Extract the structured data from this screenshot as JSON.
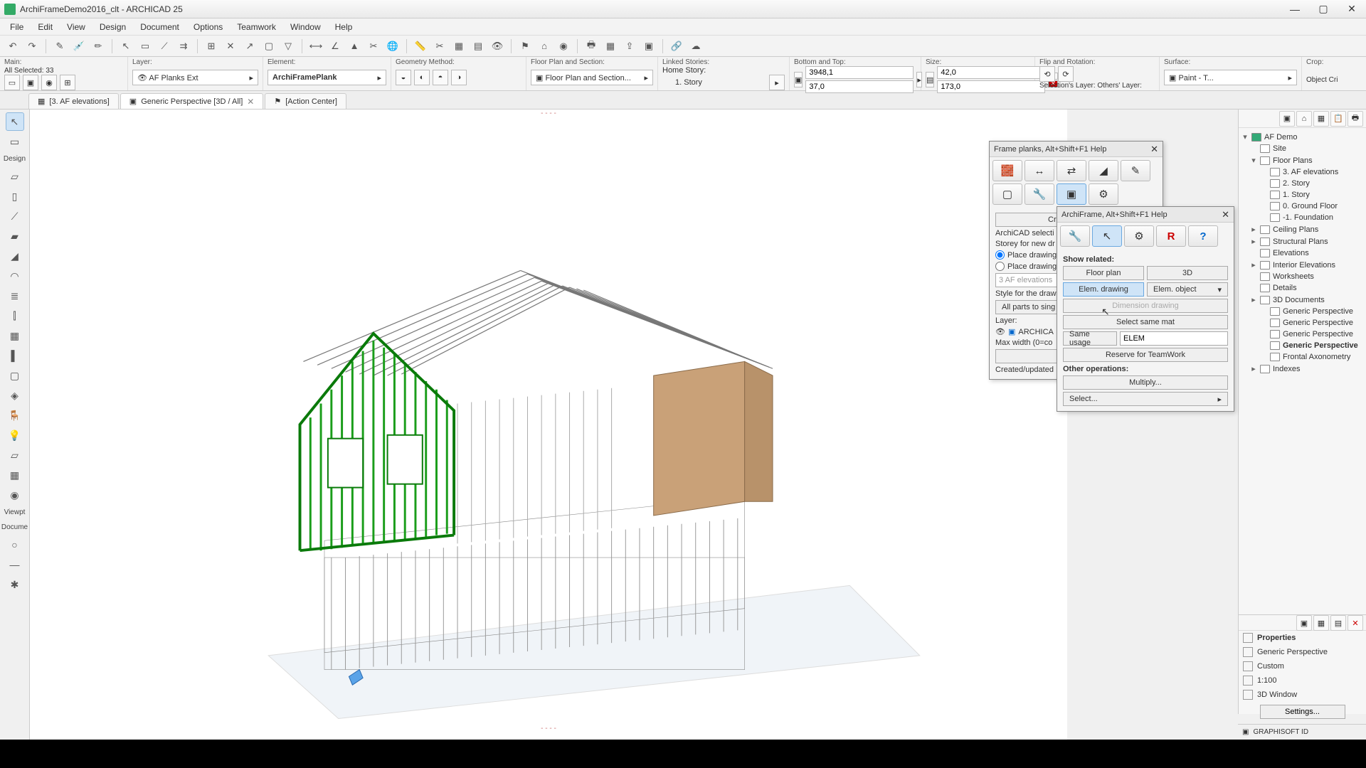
{
  "title": "ArchiFrameDemo2016_clt - ARCHICAD 25",
  "menu": [
    "File",
    "Edit",
    "View",
    "Design",
    "Document",
    "Options",
    "Teamwork",
    "Window",
    "Help"
  ],
  "infobar": {
    "main_label": "Main:",
    "selected": "All Selected: 33",
    "layer_label": "Layer:",
    "layer_value": "AF Planks Ext",
    "element_label": "Element:",
    "element_value": "ArchiFramePlank",
    "geom_label": "Geometry Method:",
    "fps_label": "Floor Plan and Section:",
    "fps_value": "Floor Plan and Section...",
    "linked_label": "Linked Stories:",
    "home_story": "Home Story:",
    "story_value": "1. Story",
    "bt_label": "Bottom and Top:",
    "bt_val1": "3948,1",
    "bt_val2": "37,0",
    "size_label": "Size:",
    "size_val1": "42,0",
    "size_val2": "173,0",
    "flip_label": "Flip and Rotation:",
    "surface_label": "Surface:",
    "surface_value": "Paint - T...",
    "crop_label": "Crop:",
    "obj_cri": "Object Cri",
    "sel_layer": "Selection's Layer:",
    "others_layer": "Others' Layer:"
  },
  "tabs": {
    "t1": "[3. AF elevations]",
    "t2": "Generic Perspective [3D / All]",
    "t3": "[Action Center]"
  },
  "lefttools": {
    "design": "Design",
    "viewpt": "Viewpt",
    "docume": "Docume"
  },
  "nav": {
    "root": "AF Demo",
    "site": "Site",
    "fp": "Floor Plans",
    "fp1": "3. AF elevations",
    "fp2": "2. Story",
    "fp3": "1. Story",
    "fp4": "0. Ground Floor",
    "fp5": "-1. Foundation",
    "cp": "Ceiling Plans",
    "sp": "Structural Plans",
    "el": "Elevations",
    "ie": "Interior Elevations",
    "ws": "Worksheets",
    "dt": "Details",
    "d3": "3D Documents",
    "gp": "Generic Perspective",
    "fa": "Frontal Axonometry",
    "idx": "Indexes"
  },
  "props": {
    "header": "Properties",
    "v1": "Generic Perspective",
    "v2": "Custom",
    "v3": "1:100",
    "v4": "3D Window",
    "settings": "Settings..."
  },
  "status": "GRAPHISOFT ID",
  "palette1": {
    "title": "Frame planks, Alt+Shift+F1 Help",
    "createupd": "Create/update d",
    "acsel": "ArchiCAD selecti",
    "storey": "Storey for new dr",
    "place1": "Place drawing",
    "place2": "Place drawing",
    "afel": "3 AF elevations",
    "style": "Style for the draw",
    "allparts": "All parts to sing",
    "layer": "Layer:",
    "layerval": "ARCHICA",
    "maxw": "Max width (0=co",
    "cre": "Cre",
    "cu": "Created/updated"
  },
  "palette2": {
    "title": "ArchiFrame, Alt+Shift+F1 Help",
    "show": "Show related:",
    "fp": "Floor plan",
    "d3": "3D",
    "eldr": "Elem. drawing",
    "elobj": "Elem. object",
    "dimdr": "Dimension drawing",
    "selmat": "Select same mat",
    "sameuse": "Same usage",
    "elem": "ELEM",
    "reserve": "Reserve for TeamWork",
    "other": "Other operations:",
    "mult": "Multiply...",
    "sel": "Select..."
  }
}
